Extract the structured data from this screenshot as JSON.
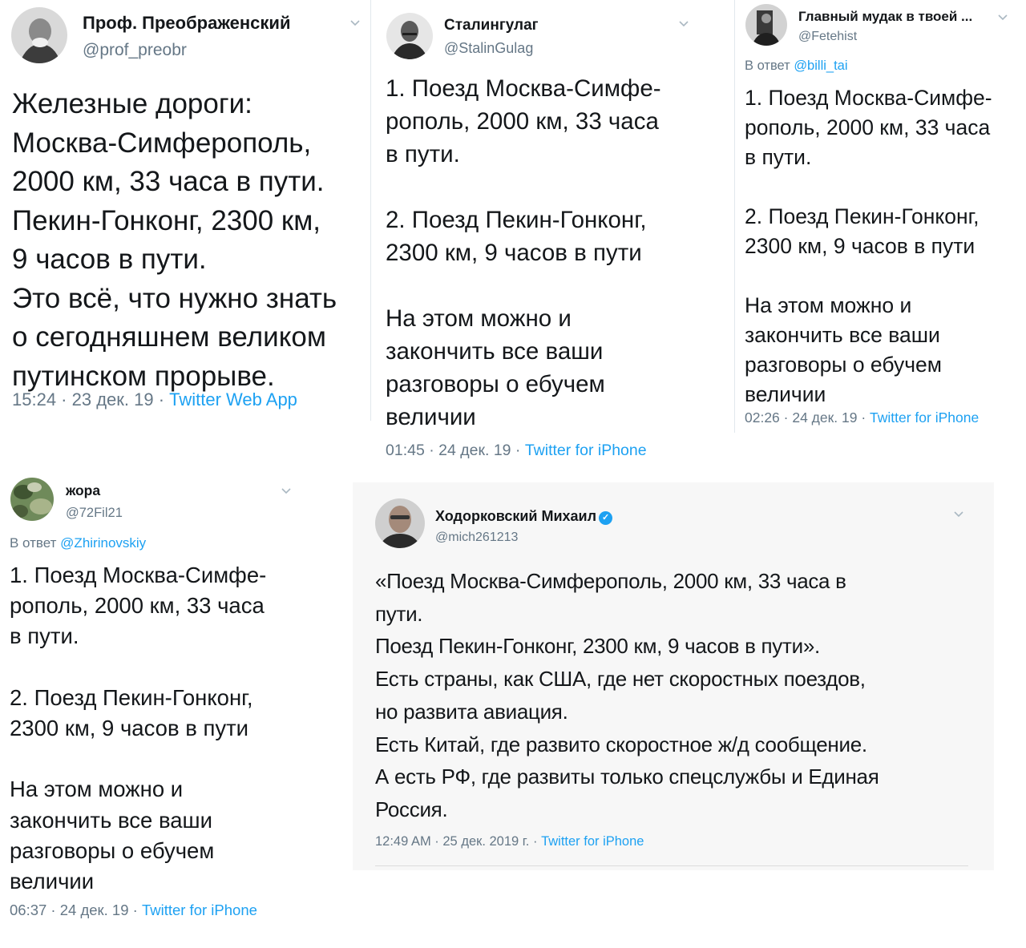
{
  "tweets": [
    {
      "name": "Проф. Преображенский",
      "handle": "@prof_preobr",
      "body": "Железные дороги:\nМосква-Симферополь,\n2000 км, 33 часа в пути.\nПекин-Гонконг, 2300 км,\n9 часов в пути.\nЭто всё, что нужно знать\nо сегодняшнем великом\nпутинском прорыве.",
      "time": "15:24 · 23 дек. 19 · ",
      "source": "Twitter Web App"
    },
    {
      "name": "Сталингулаг",
      "handle": "@StalinGulag",
      "body": "1. Поезд Москва-Симфе-\nрополь, 2000 км, 33 часа\nв пути.\n\n2. Поезд Пекин-Гонконг,\n2300 км, 9 часов в пути\n\nНа этом можно и\nзакончить все ваши\nразговоры о ебучем\nвеличии",
      "time": "01:45 · 24 дек. 19 · ",
      "source": "Twitter for iPhone"
    },
    {
      "name": "Главный мудак в твоей ...",
      "handle": "@Fetehist",
      "reply_prefix": "В ответ ",
      "reply_to": "@billi_tai",
      "body": "1. Поезд Москва-Симфе-\nрополь, 2000 км, 33 часа\nв пути.\n\n2. Поезд Пекин-Гонконг,\n2300 км, 9 часов в пути\n\nНа этом можно и\nзакончить все ваши\nразговоры о ебучем\nвеличии",
      "time": "02:26 · 24 дек. 19 · ",
      "source": "Twitter for iPhone"
    },
    {
      "name": "жора",
      "handle": "@72Fil21",
      "reply_prefix": "В ответ ",
      "reply_to": "@Zhirinovskiy",
      "body": "1. Поезд Москва-Симфе-\nрополь, 2000 км, 33 часа\nв пути.\n\n2. Поезд Пекин-Гонконг,\n2300 км, 9 часов в пути\n\nНа этом можно и\nзакончить все ваши\nразговоры о ебучем\nвеличии",
      "time": "06:37 · 24 дек. 19 · ",
      "source": "Twitter for iPhone"
    },
    {
      "name": "Ходорковский Михаил",
      "handle": "@mich261213",
      "body": "«Поезд Москва-Симферополь, 2000 км, 33 часа в\nпути.\nПоезд Пекин-Гонконг, 2300 км, 9 часов в пути».\nЕсть страны, как США, где нет скоростных поездов,\nно развита авиация.\nЕсть Китай, где развито скоростное ж/д сообщение.\nА есть РФ, где развиты только спецслужбы и Единая\nРоссия.",
      "time": "12:49 AM · 25 дек. 2019 г. · ",
      "source": "Twitter for iPhone"
    }
  ],
  "icons": {
    "chevron": "chevron-down-icon",
    "verified": "verified-badge-icon"
  }
}
